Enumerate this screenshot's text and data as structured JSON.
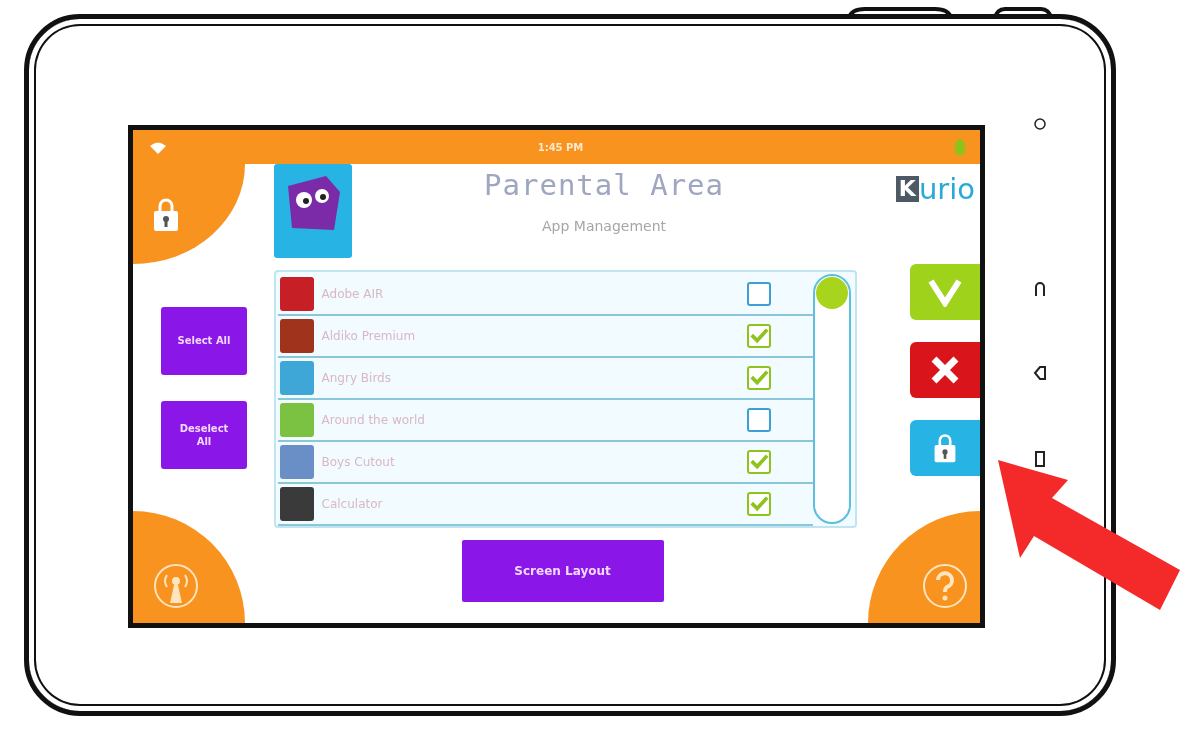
{
  "status_bar": {
    "time": "1:45 PM"
  },
  "header": {
    "title": "Parental Area",
    "subtitle": "App Management",
    "logo_mark": "K",
    "logo_text": "urio"
  },
  "sidebar": {
    "buttons": [
      "Select All",
      "Deselect All"
    ]
  },
  "apps": [
    {
      "name": "Adobe AIR",
      "checked": false,
      "color": "#c62026"
    },
    {
      "name": "Aldiko Premium",
      "checked": true,
      "color": "#a0331b"
    },
    {
      "name": "Angry Birds",
      "checked": true,
      "color": "#3fa6d8"
    },
    {
      "name": "Around the world",
      "checked": false,
      "color": "#7cc242"
    },
    {
      "name": "Boys Cutout",
      "checked": true,
      "color": "#6a8fc7"
    },
    {
      "name": "Calculator",
      "checked": true,
      "color": "#3a3a3a"
    }
  ],
  "footer_button": "Screen Layout"
}
